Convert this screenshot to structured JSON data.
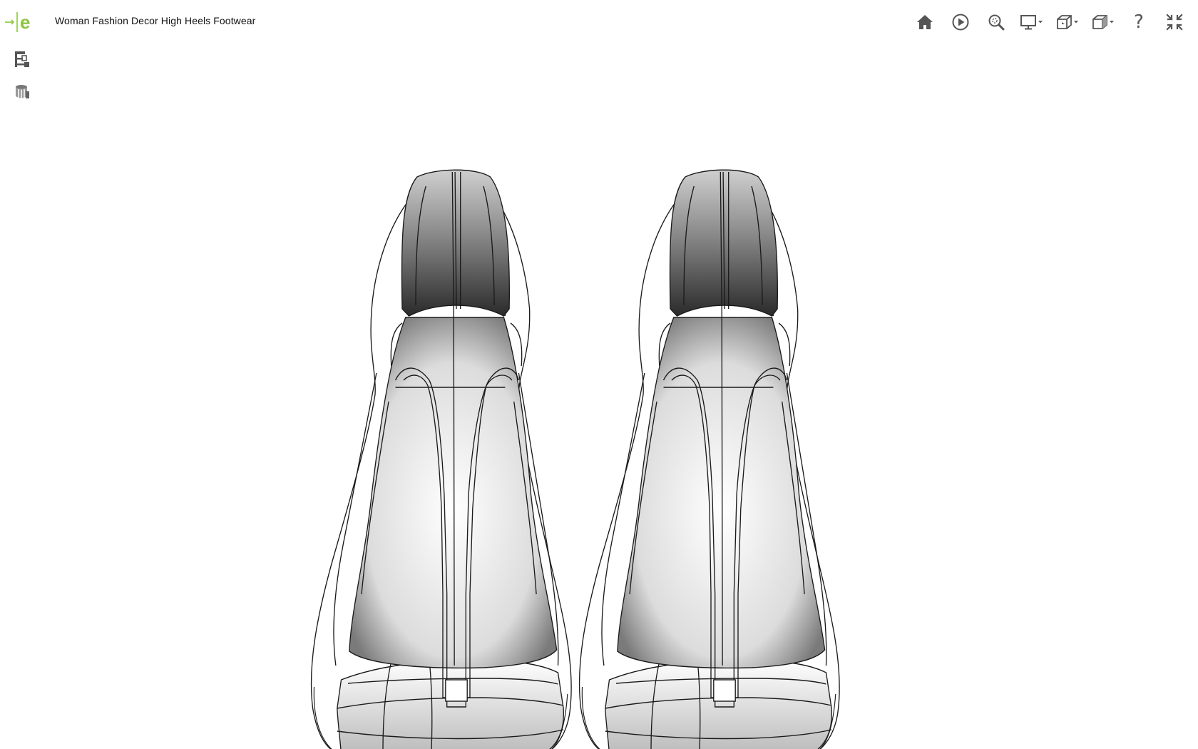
{
  "app": {
    "brand": "e",
    "title": "Woman Fashion Decor High Heels Footwear"
  },
  "colors": {
    "brand_green": "#8cc63f",
    "icon_gray": "#555555",
    "line": "#1a1a1a"
  },
  "toolbar": {
    "items": [
      {
        "icon": "home-icon"
      },
      {
        "icon": "play-icon"
      },
      {
        "icon": "zoom-icon"
      },
      {
        "icon": "display-mode-icon",
        "dropdown": true
      },
      {
        "icon": "view-orientation-icon",
        "dropdown": true
      },
      {
        "icon": "projection-icon",
        "dropdown": true
      },
      {
        "icon": "help-icon",
        "glyph": "?"
      },
      {
        "icon": "exit-fullscreen-icon"
      }
    ]
  },
  "side_panel": {
    "items": [
      {
        "icon": "model-tree-icon"
      },
      {
        "icon": "materials-icon"
      }
    ]
  },
  "viewport": {
    "model": "pair of high-heel shoes, front view, wireframe shaded"
  }
}
